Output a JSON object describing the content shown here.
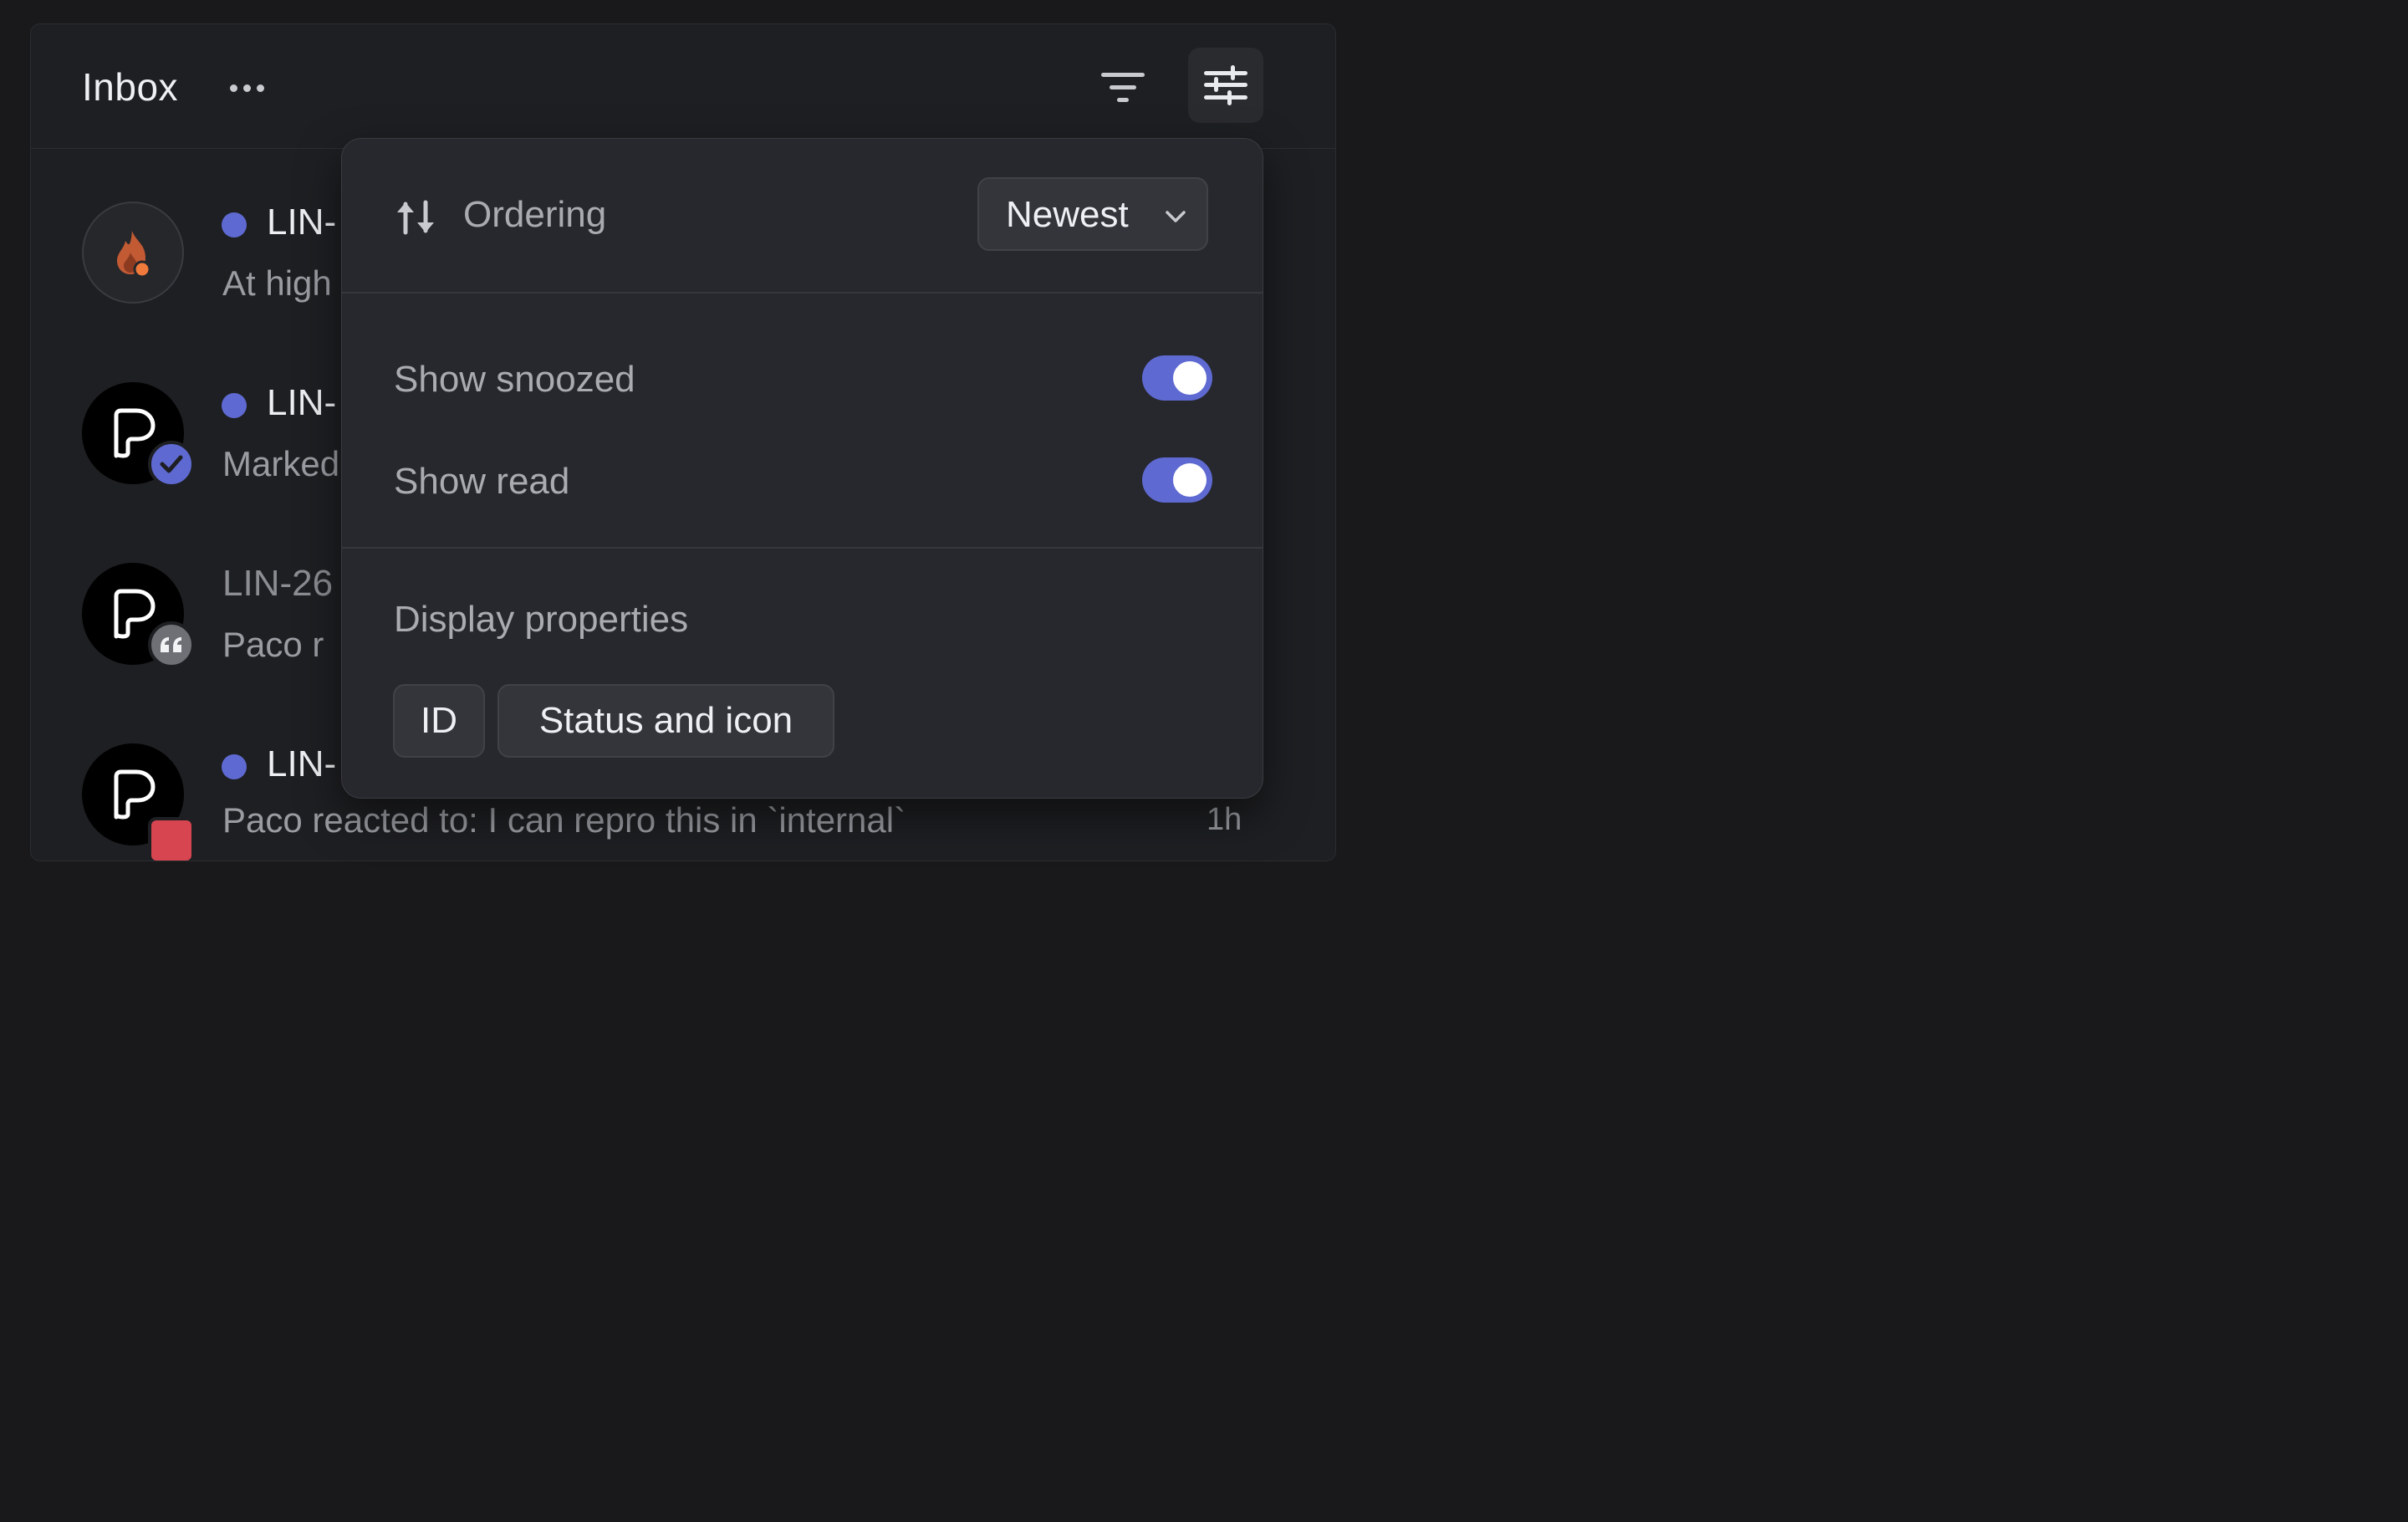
{
  "header": {
    "title": "Inbox"
  },
  "rows": [
    {
      "id": "LIN-",
      "text": "At high",
      "unread": true,
      "avatar": "fire-icon"
    },
    {
      "id": "LIN-",
      "text": "Marked",
      "unread": true,
      "avatar": "logo-p-icon",
      "badge": "check-icon"
    },
    {
      "id": "LIN-26",
      "text": "Paco r",
      "unread": false,
      "avatar": "logo-p-icon",
      "badge": "quote-icon"
    },
    {
      "id": "LIN-",
      "text": "Paco reacted to: I can repro this in `internal`",
      "time": "1h",
      "unread": true,
      "avatar": "logo-p-icon"
    }
  ],
  "popover": {
    "ordering_label": "Ordering",
    "ordering_value": "Newest",
    "toggles": [
      {
        "label": "Show snoozed",
        "on": true
      },
      {
        "label": "Show read",
        "on": true
      }
    ],
    "display_title": "Display properties",
    "chips": [
      "ID",
      "Status and icon"
    ]
  },
  "colors": {
    "accent": "#5e6ad2",
    "background": "#1e1f22",
    "popover": "#27282d",
    "fire": "#c25a34"
  }
}
